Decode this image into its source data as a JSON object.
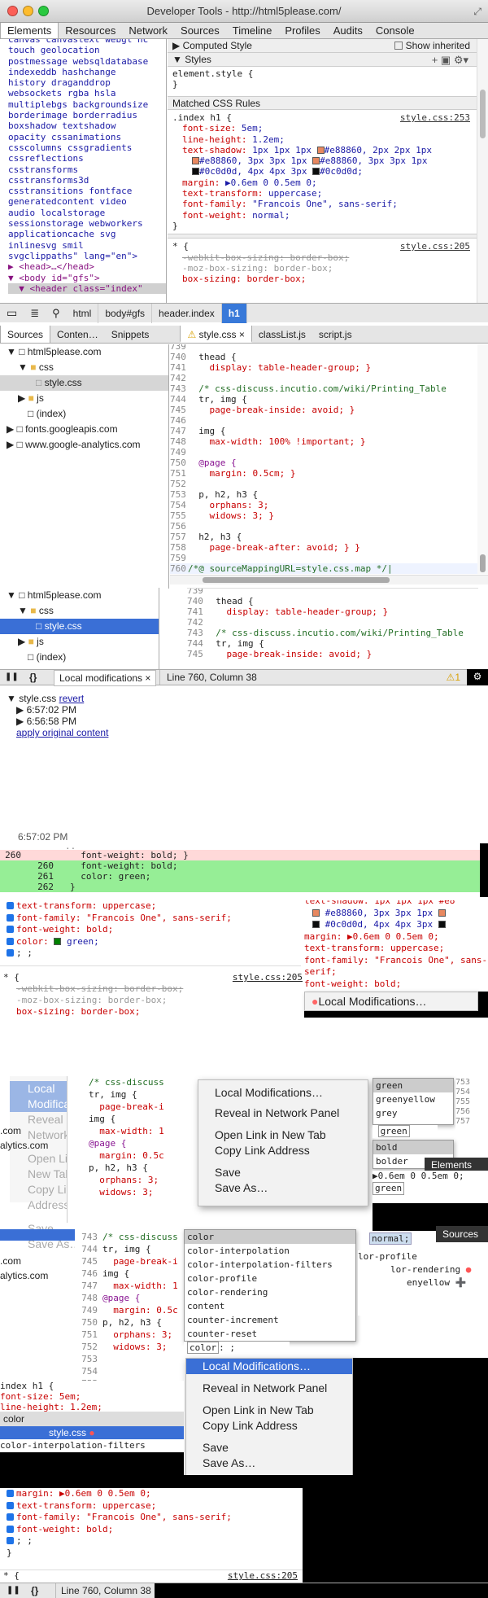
{
  "window": {
    "title": "Developer Tools - http://html5please.com/"
  },
  "tabs": [
    "Elements",
    "Resources",
    "Network",
    "Sources",
    "Timeline",
    "Profiles",
    "Audits",
    "Console"
  ],
  "dom_tree": [
    "canvas canvastext webgl hc",
    "touch geolocation",
    "postmessage websqldatabase",
    "indexeddb hashchange",
    "history draganddrop",
    "websockets rgba hsla",
    "multiplebgs backgroundsize",
    "borderimage borderradius",
    "boxshadow textshadow",
    "opacity cssanimations",
    "csscolumns cssgradients",
    "cssreflections",
    "csstransforms",
    "csstransforms3d",
    "csstransitions fontface",
    "generatedcontent video",
    "audio localstorage",
    "sessionstorage webworkers",
    "applicationcache svg",
    "inlinesvg smil",
    "svgclippaths\" lang=\"en\">",
    "▶ <head>…</head>",
    "▼ <body id=\"gfs\">",
    "  ▼ <header class=\"index\""
  ],
  "styles_panel": {
    "computed_style": "Computed Style",
    "show_inherited": "Show inherited",
    "styles": "Styles",
    "element_style": "element.style {",
    "close_brace": "}",
    "matched_rules": "Matched CSS Rules",
    "rule1_selector": ".index h1 {",
    "rule1_link": "style.css:253",
    "rule1_lines": [
      {
        "p": "font-size",
        "v": "5em;"
      },
      {
        "p": "line-height",
        "v": "1.2em;"
      },
      {
        "p": "text-shadow",
        "v": "1px 1px 1px ■#e88860, 2px 2px 1px"
      },
      {
        "p": "",
        "v": "■#e88860, 3px 3px 1px ■#e88860, 3px 3px 1px"
      },
      {
        "p": "",
        "v": "■#0c0d0d, 4px 4px 3px ■#0c0d0d;"
      },
      {
        "p": "margin",
        "v": "▶0.6em 0 0.5em 0;"
      },
      {
        "p": "text-transform",
        "v": "uppercase;"
      },
      {
        "p": "font-family",
        "v": "\"Francois One\", sans-serif;"
      },
      {
        "p": "font-weight",
        "v": "normal;"
      }
    ],
    "rule2_selector": "* {",
    "rule2_link": "style.css:205",
    "rule2_lines": [
      "-webkit-box-sizing: border-box;",
      "-moz-box-sizing: border-box;",
      "box-sizing: border-box;"
    ],
    "close_rule": "}"
  },
  "breadcrumbs": [
    "html",
    "body#gfs",
    "header.index",
    "h1"
  ],
  "sources": {
    "subtabs": [
      "Sources",
      "Conten…",
      "Snippets"
    ],
    "file_tabs": [
      "style.css",
      "classList.js",
      "script.js"
    ],
    "tree": [
      "html5please.com",
      "css",
      "style.css",
      "js",
      "(index)",
      "fonts.googleapis.com",
      "www.google-analytics.com"
    ],
    "code": [
      {
        "n": "739",
        "t": ""
      },
      {
        "n": "740",
        "t": "  thead {"
      },
      {
        "n": "741",
        "t": "    display: table-header-group; }"
      },
      {
        "n": "742",
        "t": ""
      },
      {
        "n": "743",
        "t": "  /* css-discuss.incutio.com/wiki/Printing_Table"
      },
      {
        "n": "744",
        "t": "  tr, img {"
      },
      {
        "n": "745",
        "t": "    page-break-inside: avoid; }"
      },
      {
        "n": "746",
        "t": ""
      },
      {
        "n": "747",
        "t": "  img {"
      },
      {
        "n": "748",
        "t": "    max-width: 100% !important; }"
      },
      {
        "n": "749",
        "t": ""
      },
      {
        "n": "750",
        "t": "  @page {"
      },
      {
        "n": "751",
        "t": "    margin: 0.5cm; }"
      },
      {
        "n": "752",
        "t": ""
      },
      {
        "n": "753",
        "t": "  p, h2, h3 {"
      },
      {
        "n": "754",
        "t": "    orphans: 3;"
      },
      {
        "n": "755",
        "t": "    widows: 3; }"
      },
      {
        "n": "756",
        "t": ""
      },
      {
        "n": "757",
        "t": "  h2, h3 {"
      },
      {
        "n": "758",
        "t": "    page-break-after: avoid; } }"
      },
      {
        "n": "759",
        "t": ""
      },
      {
        "n": "760",
        "t": "/*@ sourceMappingURL=style.css.map */"
      }
    ],
    "code2": [
      {
        "n": "739",
        "t": ""
      },
      {
        "n": "740",
        "t": "  thead {"
      },
      {
        "n": "741",
        "t": "    display: table-header-group; }"
      },
      {
        "n": "742",
        "t": ""
      },
      {
        "n": "743",
        "t": "  /* css-discuss.incutio.com/wiki/Printing_Table"
      },
      {
        "n": "744",
        "t": "  tr, img {"
      },
      {
        "n": "745",
        "t": "    page-break-inside: avoid; }"
      }
    ],
    "bottom_tab": "Local modifications",
    "status": "Line 760, Column 38",
    "warn_count": "1"
  },
  "local_mods": {
    "file": "style.css",
    "revert": "revert",
    "times": [
      "6:57:02 PM",
      "6:56:58 PM"
    ],
    "apply": "apply original content"
  },
  "diff": {
    "time": "6:57:02 PM",
    "lines": [
      {
        "a": "260",
        "b": "",
        "t": "  font-weight: bold; }",
        "kind": "del"
      },
      {
        "a": "",
        "b": "260",
        "t": "  font-weight: bold;",
        "kind": "add"
      },
      {
        "a": "",
        "b": "261",
        "t": "  color: green;",
        "kind": "add"
      },
      {
        "a": "",
        "b": "262",
        "t": "}",
        "kind": "add"
      }
    ]
  },
  "edited_rule": [
    "text-transform: uppercase;",
    "font-family: \"Francois One\", sans-serif;",
    "font-weight: bold;",
    "color: ■green;",
    "; ;"
  ],
  "context_menu": {
    "local_mods": "Local Modifications…",
    "reveal": "Reveal in Network Panel",
    "open_link": "Open Link in New Tab",
    "copy_link": "Copy Link Address",
    "save": "Save",
    "save_as": "Save As…"
  },
  "autocomplete_color": [
    "green",
    "greenyellow",
    "grey"
  ],
  "autocomplete_weight": [
    "bold",
    "bolder"
  ],
  "autocomplete_props": [
    "color",
    "color-interpolation",
    "color-interpolation-filters",
    "color-profile",
    "color-rendering",
    "content",
    "counter-increment",
    "counter-reset"
  ],
  "misc": {
    "elements_label": "Elements",
    "sources_label": "Sources",
    "normal": "normal;",
    "green_input": "green",
    "index_h1": "index h1 {",
    "font_size": "font-size: 5em;",
    "line_height": "line-height: 1.2em;",
    "color_label": "color",
    "style_css": "style.css",
    "bottom_rule": [
      "margin: ▶0.6em 0 0.5em 0;",
      "text-transform: uppercase;",
      "font-family: \"Francois One\", sans-serif;",
      "font-weight: bold;",
      "; ;"
    ],
    "bottom_link": "style.css:205"
  }
}
